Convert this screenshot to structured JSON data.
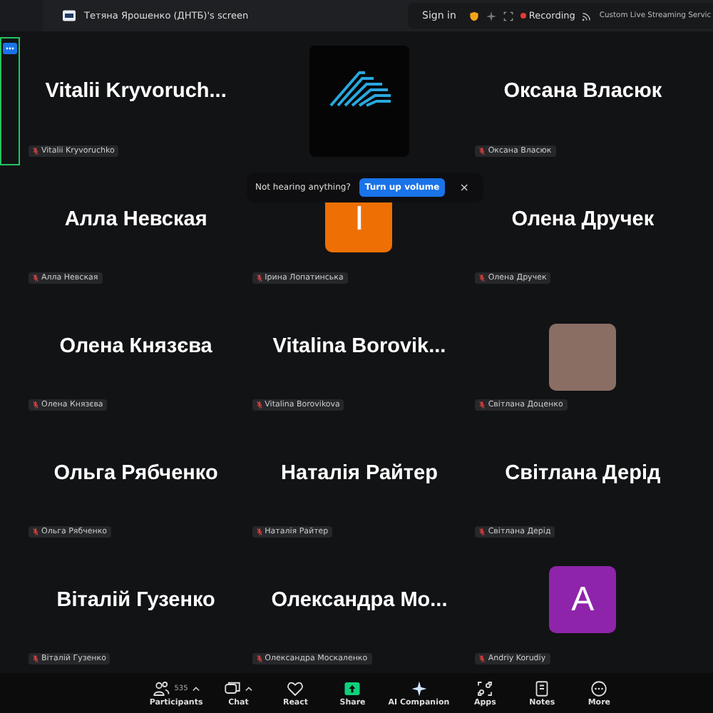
{
  "window": {
    "title": "Тетяна Ярошенко (ДНТБ)'s screen"
  },
  "top_bar": {
    "sign_in": "Sign in",
    "recording": "Recording",
    "streaming": "Custom Live Streaming Servic"
  },
  "tiles": [
    {
      "kind": "name",
      "display": "Vitalii  Kryvoruch...",
      "label": "Vitalii Kryvoruchko"
    },
    {
      "kind": "logo"
    },
    {
      "kind": "name",
      "display": "Оксана Власюк",
      "label": "Оксана Власюк"
    },
    {
      "kind": "name",
      "display": "Алла Невская",
      "label": "Алла Невская"
    },
    {
      "kind": "avatar",
      "letter": "I",
      "color": "#ee7004",
      "label": "Ірина Лопатинська"
    },
    {
      "kind": "name",
      "display": "Олена Дручек",
      "label": "Олена Дручек"
    },
    {
      "kind": "name",
      "display": "Олена Князєва",
      "label": "Олена Князєва"
    },
    {
      "kind": "name",
      "display": "Vitalina  Borovik...",
      "label": "Vitalina Borovikova"
    },
    {
      "kind": "photo",
      "label": "Світлана Доценко"
    },
    {
      "kind": "name",
      "display": "Ольга Рябченко",
      "label": "Ольга Рябченко"
    },
    {
      "kind": "name",
      "display": "Наталія Райтер",
      "label": "Наталія Райтер"
    },
    {
      "kind": "name",
      "display": "Світлана Дерід",
      "label": "Світлана Дерід"
    },
    {
      "kind": "name",
      "display": "Віталій Гузенко",
      "label": "Віталій Гузенко"
    },
    {
      "kind": "name",
      "display": "Олександра  Мо...",
      "label": "Олександра Москаленко"
    },
    {
      "kind": "avatar",
      "letter": "A",
      "color": "#8e24aa",
      "label": "Andriy Korudiy"
    }
  ],
  "toast": {
    "text": "Not hearing anything?",
    "button": "Turn up volume",
    "close": "×"
  },
  "toolbar": [
    {
      "kind": "participants",
      "label": "Participants",
      "count": "535",
      "caret": true
    },
    {
      "kind": "chat",
      "label": "Chat",
      "caret": true
    },
    {
      "kind": "react",
      "label": "React",
      "caret": false
    },
    {
      "kind": "share",
      "label": "Share",
      "caret": false
    },
    {
      "kind": "ai",
      "label": "AI Companion",
      "caret": false
    },
    {
      "kind": "apps",
      "label": "Apps",
      "caret": false
    },
    {
      "kind": "notes",
      "label": "Notes",
      "caret": false
    },
    {
      "kind": "more",
      "label": "More",
      "caret": false
    }
  ]
}
